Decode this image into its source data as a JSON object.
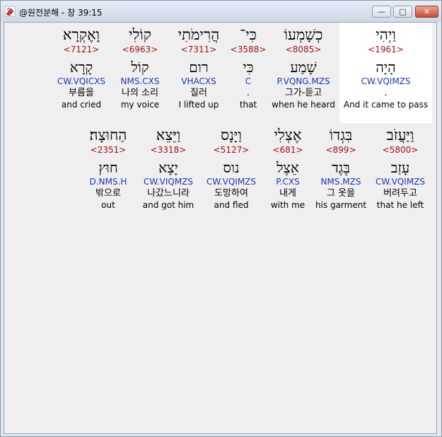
{
  "window": {
    "title": "@원전분해 - 창 39:15",
    "minimize_glyph": "—",
    "maximize_glyph": "□",
    "close_glyph": "✕"
  },
  "verse": {
    "row1": [
      {
        "hebrew": "וַיְהִי",
        "strong": "<1961>",
        "lemma": "הָיָה",
        "parse": "CW.VQIMZS",
        "korean": ".",
        "english": "And it came to pass",
        "highlighted": true
      },
      {
        "hebrew": "כְשָׁמְעוֹ",
        "strong": "<8085>",
        "lemma": "שָׁמַע",
        "parse": "P.VQNG.MZS",
        "korean": "그가-듣고",
        "english": "when he heard",
        "highlighted": false
      },
      {
        "hebrew": "כִּי־",
        "strong": "<3588>",
        "lemma": "כִּי",
        "parse": "C",
        "korean": ".",
        "english": "that",
        "highlighted": false
      },
      {
        "hebrew": "הֲרִימֹתִי",
        "strong": "<7311>",
        "lemma": "רום",
        "parse": "VHACXS",
        "korean": "질러",
        "english": "I lifted up",
        "highlighted": false
      },
      {
        "hebrew": "קוֹלִי",
        "strong": "<6963>",
        "lemma": "קוֹל",
        "parse": "NMS.CXS",
        "korean": "나의 소리",
        "english": "my voice",
        "highlighted": false
      },
      {
        "hebrew": "וָאֶקְרָא",
        "strong": "<7121>",
        "lemma": "קָרָא",
        "parse": "CW.VQICXS",
        "korean": "부름을",
        "english": "and cried",
        "highlighted": false
      }
    ],
    "row2": [
      {
        "hebrew": "וַיַּעֲזֹב",
        "strong": "<5800>",
        "lemma": "עָזַב",
        "parse": "CW.VQIMZS",
        "korean": "버려두고",
        "english": "that he left",
        "highlighted": false
      },
      {
        "hebrew": "בִּגְדוֹ",
        "strong": "<899>",
        "lemma": "בֶּגֶד",
        "parse": "NMS.MZS",
        "korean": "그 옷을",
        "english": "his garment",
        "highlighted": false
      },
      {
        "hebrew": "אֶצְלִי",
        "strong": "<681>",
        "lemma": "אֵצֶל",
        "parse": "P.CXS",
        "korean": "내게",
        "english": "with me",
        "highlighted": false
      },
      {
        "hebrew": "וַיָּנָס",
        "strong": "<5127>",
        "lemma": "נוס",
        "parse": "CW.VQIMZS",
        "korean": "도망하여",
        "english": "and fled",
        "highlighted": false
      },
      {
        "hebrew": "וַיֵּצֵא",
        "strong": "<3318>",
        "lemma": "יָצָא",
        "parse": "CW.VIQMZS",
        "korean": "나갔느니라",
        "english": "and got him",
        "highlighted": false
      },
      {
        "hebrew": "הַחוּצָה׃",
        "strong": "<2351>",
        "lemma": "חוּץ",
        "parse": "D.NMS.H",
        "korean": "밖으로",
        "english": "out",
        "highlighted": false
      }
    ]
  }
}
